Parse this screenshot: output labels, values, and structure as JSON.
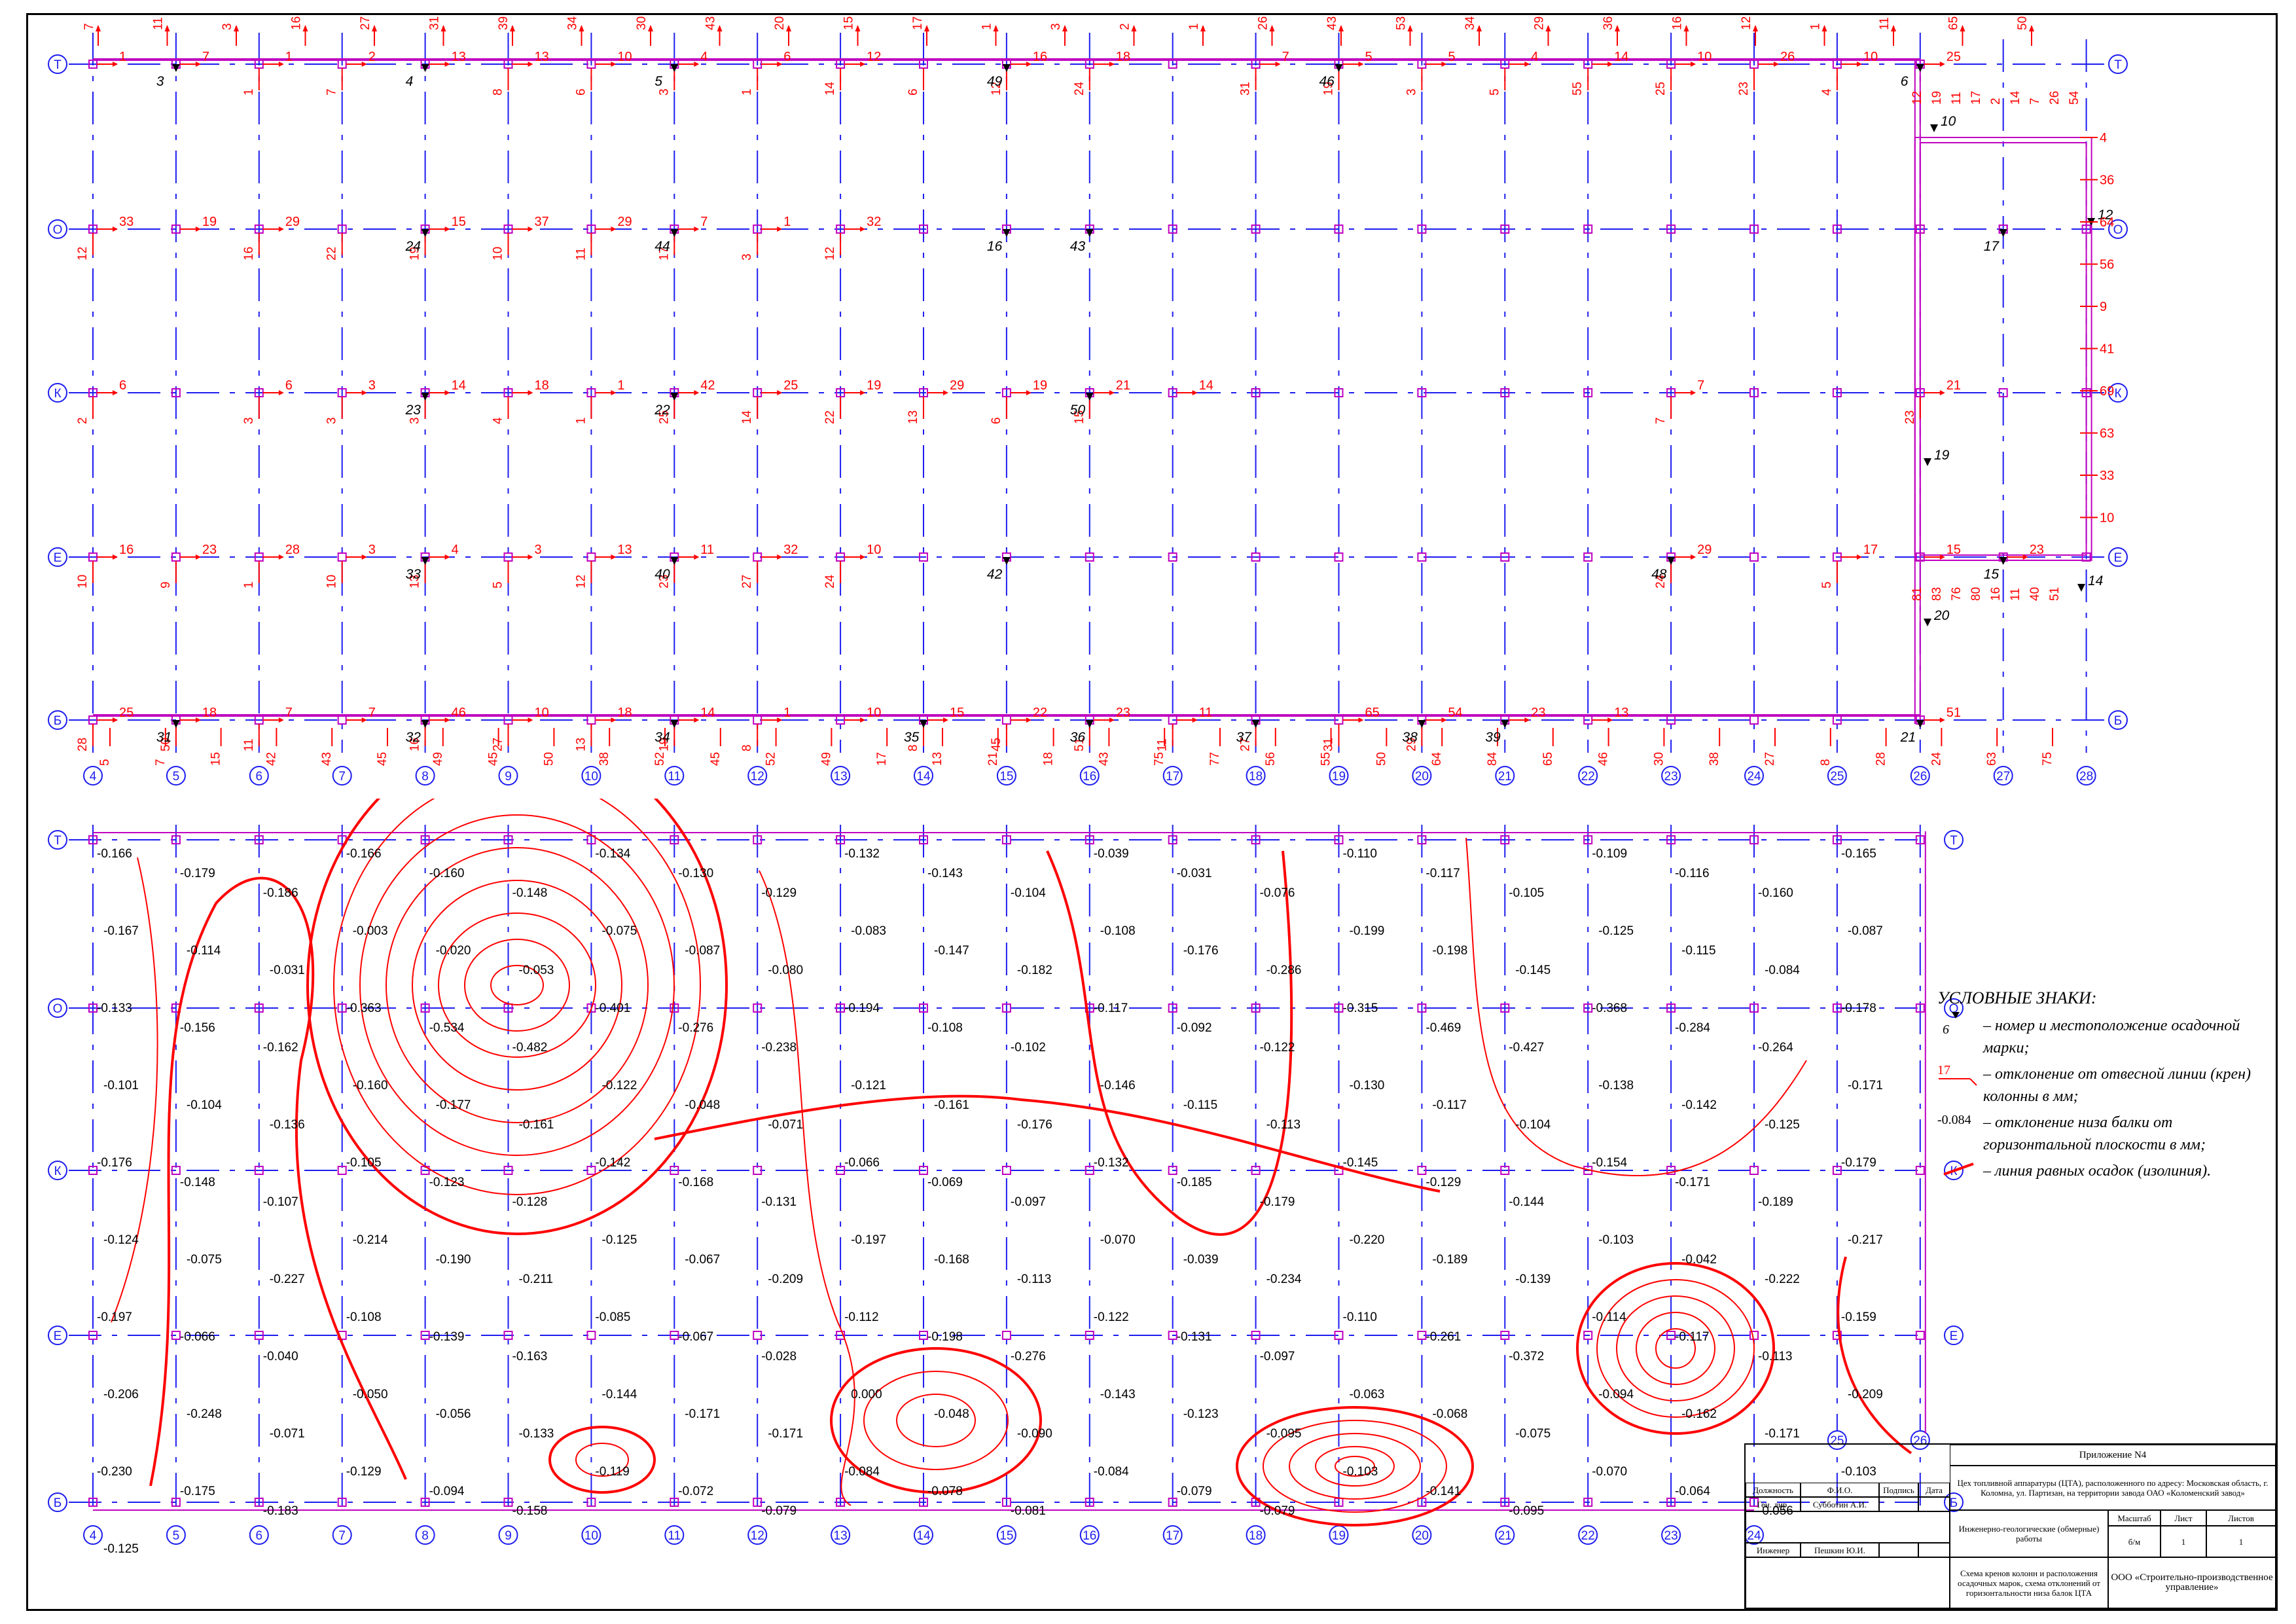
{
  "colors": {
    "grid": "#1d1df0",
    "red": "#ff0000",
    "mark": "#c000c0",
    "black": "#000000"
  },
  "plan1": {
    "axes_x": [
      "4",
      "5",
      "6",
      "7",
      "8",
      "9",
      "10",
      "11",
      "12",
      "13",
      "14",
      "15",
      "16",
      "17",
      "18",
      "19",
      "20",
      "21",
      "22",
      "23",
      "24",
      "25",
      "26",
      "27",
      "28"
    ],
    "axes_y": [
      "Т",
      "О",
      "К",
      "Е",
      "Б"
    ],
    "top_numbers": [
      "7",
      "11",
      "3",
      "16",
      "27",
      "31",
      "39",
      "34",
      "30",
      "43",
      "20",
      "15",
      "17",
      "1",
      "3",
      "2",
      "1",
      "26",
      "43",
      "53",
      "34",
      "29",
      "36",
      "16",
      "12",
      "1",
      "11",
      "65",
      "50"
    ],
    "red_numbers": [
      {
        "c": 0,
        "r": 0,
        "t": "1"
      },
      {
        "c": 1,
        "r": 0,
        "t": "7"
      },
      {
        "c": 2,
        "r": 0,
        "t": "1"
      },
      {
        "c": 3,
        "r": 0,
        "t": "2"
      },
      {
        "c": 4,
        "r": 0,
        "t": "13"
      },
      {
        "c": 5,
        "r": 0,
        "t": "13"
      },
      {
        "c": 6,
        "r": 0,
        "t": "10"
      },
      {
        "c": 7,
        "r": 0,
        "t": "4"
      },
      {
        "c": 8,
        "r": 0,
        "t": "6"
      },
      {
        "c": 9,
        "r": 0,
        "t": "12"
      },
      {
        "c": 11,
        "r": 0,
        "t": "16"
      },
      {
        "c": 12,
        "r": 0,
        "t": "18"
      },
      {
        "c": 14,
        "r": 0,
        "t": "7"
      },
      {
        "c": 15,
        "r": 0,
        "t": "5"
      },
      {
        "c": 16,
        "r": 0,
        "t": "5"
      },
      {
        "c": 17,
        "r": 0,
        "t": "4"
      },
      {
        "c": 18,
        "r": 0,
        "t": "14"
      },
      {
        "c": 19,
        "r": 0,
        "t": "10"
      },
      {
        "c": 20,
        "r": 0,
        "t": "26"
      },
      {
        "c": 21,
        "r": 0,
        "t": "10"
      },
      {
        "c": 22,
        "r": 0,
        "t": "25"
      },
      {
        "c": 0,
        "r": 1,
        "t": "33"
      },
      {
        "c": 1,
        "r": 1,
        "t": "19"
      },
      {
        "c": 2,
        "r": 1,
        "t": "29"
      },
      {
        "c": 4,
        "r": 1,
        "t": "15"
      },
      {
        "c": 5,
        "r": 1,
        "t": "37"
      },
      {
        "c": 6,
        "r": 1,
        "t": "29"
      },
      {
        "c": 7,
        "r": 1,
        "t": "7"
      },
      {
        "c": 8,
        "r": 1,
        "t": "1"
      },
      {
        "c": 9,
        "r": 1,
        "t": "32"
      },
      {
        "c": 0,
        "r": 2,
        "t": "6"
      },
      {
        "c": 2,
        "r": 2,
        "t": "6"
      },
      {
        "c": 3,
        "r": 2,
        "t": "3"
      },
      {
        "c": 4,
        "r": 2,
        "t": "14"
      },
      {
        "c": 5,
        "r": 2,
        "t": "18"
      },
      {
        "c": 6,
        "r": 2,
        "t": "1"
      },
      {
        "c": 7,
        "r": 2,
        "t": "42"
      },
      {
        "c": 8,
        "r": 2,
        "t": "25"
      },
      {
        "c": 9,
        "r": 2,
        "t": "19"
      },
      {
        "c": 10,
        "r": 2,
        "t": "29"
      },
      {
        "c": 11,
        "r": 2,
        "t": "19"
      },
      {
        "c": 12,
        "r": 2,
        "t": "21"
      },
      {
        "c": 13,
        "r": 2,
        "t": "14"
      },
      {
        "c": 19,
        "r": 2,
        "t": "7"
      },
      {
        "c": 22,
        "r": 2,
        "t": "21"
      },
      {
        "c": 0,
        "r": 3,
        "t": "16"
      },
      {
        "c": 1,
        "r": 3,
        "t": "23"
      },
      {
        "c": 2,
        "r": 3,
        "t": "28"
      },
      {
        "c": 3,
        "r": 3,
        "t": "3"
      },
      {
        "c": 4,
        "r": 3,
        "t": "4"
      },
      {
        "c": 5,
        "r": 3,
        "t": "3"
      },
      {
        "c": 6,
        "r": 3,
        "t": "13"
      },
      {
        "c": 7,
        "r": 3,
        "t": "11"
      },
      {
        "c": 8,
        "r": 3,
        "t": "32"
      },
      {
        "c": 9,
        "r": 3,
        "t": "10"
      },
      {
        "c": 19,
        "r": 3,
        "t": "29"
      },
      {
        "c": 21,
        "r": 3,
        "t": "17"
      },
      {
        "c": 22,
        "r": 3,
        "t": "15"
      },
      {
        "c": 23,
        "r": 3,
        "t": "23"
      },
      {
        "c": 0,
        "r": 4,
        "t": "25"
      },
      {
        "c": 1,
        "r": 4,
        "t": "18"
      },
      {
        "c": 2,
        "r": 4,
        "t": "7"
      },
      {
        "c": 3,
        "r": 4,
        "t": "7"
      },
      {
        "c": 4,
        "r": 4,
        "t": "46"
      },
      {
        "c": 5,
        "r": 4,
        "t": "10"
      },
      {
        "c": 6,
        "r": 4,
        "t": "18"
      },
      {
        "c": 7,
        "r": 4,
        "t": "14"
      },
      {
        "c": 8,
        "r": 4,
        "t": "1"
      },
      {
        "c": 9,
        "r": 4,
        "t": "10"
      },
      {
        "c": 10,
        "r": 4,
        "t": "15"
      },
      {
        "c": 11,
        "r": 4,
        "t": "22"
      },
      {
        "c": 12,
        "r": 4,
        "t": "23"
      },
      {
        "c": 13,
        "r": 4,
        "t": "11"
      },
      {
        "c": 15,
        "r": 4,
        "t": "65"
      },
      {
        "c": 16,
        "r": 4,
        "t": "54"
      },
      {
        "c": 17,
        "r": 4,
        "t": "23"
      },
      {
        "c": 18,
        "r": 4,
        "t": "13"
      },
      {
        "c": 22,
        "r": 4,
        "t": "51"
      }
    ],
    "vert_numbers": [
      {
        "c": 0,
        "r": 1,
        "t": "12"
      },
      {
        "c": 0,
        "r": 2,
        "t": "2"
      },
      {
        "c": 0,
        "r": 3,
        "t": "10"
      },
      {
        "c": 0,
        "r": 4,
        "t": "28"
      },
      {
        "c": 1,
        "r": 3,
        "t": "9"
      },
      {
        "c": 1,
        "r": 4,
        "t": "50"
      },
      {
        "c": 2,
        "r": 0,
        "t": "1"
      },
      {
        "c": 2,
        "r": 1,
        "t": "16"
      },
      {
        "c": 2,
        "r": 2,
        "t": "3"
      },
      {
        "c": 2,
        "r": 3,
        "t": "1"
      },
      {
        "c": 2,
        "r": 4,
        "t": "11"
      },
      {
        "c": 3,
        "r": 0,
        "t": "7"
      },
      {
        "c": 3,
        "r": 1,
        "t": "22"
      },
      {
        "c": 3,
        "r": 2,
        "t": "3"
      },
      {
        "c": 3,
        "r": 3,
        "t": "10"
      },
      {
        "c": 4,
        "r": 1,
        "t": "19"
      },
      {
        "c": 4,
        "r": 2,
        "t": "3"
      },
      {
        "c": 4,
        "r": 3,
        "t": "13"
      },
      {
        "c": 4,
        "r": 4,
        "t": "16"
      },
      {
        "c": 5,
        "r": 0,
        "t": "8"
      },
      {
        "c": 5,
        "r": 1,
        "t": "10"
      },
      {
        "c": 5,
        "r": 2,
        "t": "4"
      },
      {
        "c": 5,
        "r": 3,
        "t": "5"
      },
      {
        "c": 5,
        "r": 4,
        "t": "27"
      },
      {
        "c": 6,
        "r": 0,
        "t": "6"
      },
      {
        "c": 6,
        "r": 1,
        "t": "11"
      },
      {
        "c": 6,
        "r": 2,
        "t": "1"
      },
      {
        "c": 6,
        "r": 3,
        "t": "12"
      },
      {
        "c": 6,
        "r": 4,
        "t": "13"
      },
      {
        "c": 7,
        "r": 0,
        "t": "3"
      },
      {
        "c": 7,
        "r": 1,
        "t": "17"
      },
      {
        "c": 7,
        "r": 2,
        "t": "25"
      },
      {
        "c": 7,
        "r": 3,
        "t": "23"
      },
      {
        "c": 7,
        "r": 4,
        "t": "19"
      },
      {
        "c": 8,
        "r": 0,
        "t": "1"
      },
      {
        "c": 8,
        "r": 1,
        "t": "3"
      },
      {
        "c": 8,
        "r": 2,
        "t": "14"
      },
      {
        "c": 8,
        "r": 3,
        "t": "27"
      },
      {
        "c": 8,
        "r": 4,
        "t": "8"
      },
      {
        "c": 9,
        "r": 0,
        "t": "14"
      },
      {
        "c": 9,
        "r": 1,
        "t": "12"
      },
      {
        "c": 9,
        "r": 2,
        "t": "22"
      },
      {
        "c": 9,
        "r": 3,
        "t": "24"
      },
      {
        "c": 10,
        "r": 0,
        "t": "6"
      },
      {
        "c": 10,
        "r": 2,
        "t": "13"
      },
      {
        "c": 10,
        "r": 4,
        "t": "8"
      },
      {
        "c": 11,
        "r": 0,
        "t": "12"
      },
      {
        "c": 11,
        "r": 2,
        "t": "6"
      },
      {
        "c": 11,
        "r": 4,
        "t": "45"
      },
      {
        "c": 12,
        "r": 0,
        "t": "24"
      },
      {
        "c": 12,
        "r": 2,
        "t": "15"
      },
      {
        "c": 12,
        "r": 4,
        "t": "51"
      },
      {
        "c": 13,
        "r": 4,
        "t": "11"
      },
      {
        "c": 14,
        "r": 0,
        "t": "31"
      },
      {
        "c": 14,
        "r": 4,
        "t": "27"
      },
      {
        "c": 15,
        "r": 0,
        "t": "19"
      },
      {
        "c": 15,
        "r": 4,
        "t": "31"
      },
      {
        "c": 16,
        "r": 0,
        "t": "3"
      },
      {
        "c": 16,
        "r": 4,
        "t": "29"
      },
      {
        "c": 17,
        "r": 0,
        "t": "5"
      },
      {
        "c": 18,
        "r": 0,
        "t": "55"
      },
      {
        "c": 19,
        "r": 0,
        "t": "25"
      },
      {
        "c": 19,
        "r": 2,
        "t": "7"
      },
      {
        "c": 19,
        "r": 3,
        "t": "24"
      },
      {
        "c": 20,
        "r": 0,
        "t": "23"
      },
      {
        "c": 21,
        "r": 0,
        "t": "4"
      },
      {
        "c": 21,
        "r": 3,
        "t": "5"
      },
      {
        "c": 22,
        "r": 2,
        "t": "23"
      }
    ],
    "bottom_numbers": [
      "5",
      "7",
      "15",
      "42",
      "43",
      "45",
      "49",
      "45",
      "50",
      "38",
      "52",
      "45",
      "52",
      "49",
      "17",
      "13",
      "21",
      "18",
      "43",
      "75",
      "77",
      "56",
      "55",
      "50",
      "64",
      "84",
      "65",
      "46",
      "30",
      "38",
      "27",
      "8",
      "28",
      "24",
      "63",
      "75"
    ],
    "markers": [
      {
        "c": 1,
        "r": 0,
        "t": "3"
      },
      {
        "c": 4,
        "r": 0,
        "t": "4"
      },
      {
        "c": 7,
        "r": 0,
        "t": "5"
      },
      {
        "c": 11,
        "r": 0,
        "t": "49"
      },
      {
        "c": 15,
        "r": 0,
        "t": "46"
      },
      {
        "c": 22,
        "r": 0,
        "t": "6"
      },
      {
        "c": 4,
        "r": 1,
        "t": "24"
      },
      {
        "c": 7,
        "r": 1,
        "t": "44"
      },
      {
        "c": 11,
        "r": 1,
        "t": "16"
      },
      {
        "c": 12,
        "r": 1,
        "t": "43"
      },
      {
        "c": 23,
        "r": 1,
        "t": "17"
      },
      {
        "c": 4,
        "r": 2,
        "t": "23"
      },
      {
        "c": 7,
        "r": 2,
        "t": "22"
      },
      {
        "c": 12,
        "r": 2,
        "t": "50"
      },
      {
        "c": 4,
        "r": 3,
        "t": "33"
      },
      {
        "c": 7,
        "r": 3,
        "t": "40"
      },
      {
        "c": 11,
        "r": 3,
        "t": "42"
      },
      {
        "c": 19,
        "r": 3,
        "t": "48"
      },
      {
        "c": 23,
        "r": 3,
        "t": "15"
      },
      {
        "c": 1,
        "r": 4,
        "t": "31"
      },
      {
        "c": 4,
        "r": 4,
        "t": "32"
      },
      {
        "c": 7,
        "r": 4,
        "t": "34"
      },
      {
        "c": 10,
        "r": 4,
        "t": "35"
      },
      {
        "c": 12,
        "r": 4,
        "t": "36"
      },
      {
        "c": 14,
        "r": 4,
        "t": "37"
      },
      {
        "c": 16,
        "r": 4,
        "t": "38"
      },
      {
        "c": 17,
        "r": 4,
        "t": "39"
      },
      {
        "c": 22,
        "r": 4,
        "t": "21"
      }
    ],
    "extra_markers": [
      "10",
      "12",
      "19",
      "20",
      "14"
    ],
    "right_numbers": [
      "4",
      "36",
      "64",
      "56",
      "9",
      "41",
      "69",
      "63",
      "33",
      "10"
    ],
    "right_lower_numbers": [
      "12",
      "19",
      "11",
      "17",
      "2",
      "14",
      "7",
      "26",
      "54",
      "81",
      "83",
      "76",
      "80",
      "16",
      "11",
      "40",
      "51"
    ]
  },
  "plan2": {
    "axes_x": [
      "4",
      "5",
      "6",
      "7",
      "8",
      "9",
      "10",
      "11",
      "12",
      "13",
      "14",
      "15",
      "16",
      "17",
      "18",
      "19",
      "20",
      "21",
      "22",
      "23",
      "24",
      "25",
      "26"
    ],
    "axes_y": [
      "Т",
      "О",
      "К",
      "Е",
      "Б"
    ],
    "values": [
      "-0.166",
      "-0.179",
      "-0.186",
      "-0.166",
      "-0.160",
      "-0.148",
      "-0.134",
      "-0.130",
      "-0.129",
      "-0.132",
      "-0.143",
      "-0.104",
      "-0.039",
      "-0.031",
      "-0.076",
      "-0.110",
      "-0.117",
      "-0.105",
      "-0.109",
      "-0.116",
      "-0.160",
      "-0.165",
      "-0.167",
      "-0.114",
      "-0.031",
      "-0.003",
      "-0.020",
      "-0.053",
      "-0.075",
      "-0.087",
      "-0.080",
      "-0.083",
      "-0.147",
      "-0.182",
      "-0.108",
      "-0.176",
      "-0.286",
      "-0.199",
      "-0.198",
      "-0.145",
      "-0.125",
      "-0.115",
      "-0.084",
      "-0.087",
      "-0.133",
      "-0.156",
      "-0.162",
      "-0.363",
      "-0.534",
      "-0.482",
      "-0.401",
      "-0.276",
      "-0.238",
      "-0.194",
      "-0.108",
      "-0.102",
      "-0.117",
      "-0.092",
      "-0.122",
      "-0.315",
      "-0.469",
      "-0.427",
      "-0.368",
      "-0.284",
      "-0.264",
      "-0.178",
      "-0.101",
      "-0.104",
      "-0.136",
      "-0.160",
      "-0.177",
      "-0.161",
      "-0.122",
      "-0.048",
      "-0.071",
      "-0.121",
      "-0.161",
      "-0.176",
      "-0.146",
      "-0.115",
      "-0.113",
      "-0.130",
      "-0.117",
      "-0.104",
      "-0.138",
      "-0.142",
      "-0.125",
      "-0.171",
      "-0.176",
      "-0.148",
      "-0.107",
      "-0.105",
      "-0.123",
      "-0.128",
      "-0.142",
      "-0.168",
      "-0.131",
      "-0.066",
      "-0.069",
      "-0.097",
      "-0.132",
      "-0.185",
      "-0.179",
      "-0.145",
      "-0.129",
      "-0.144",
      "-0.154",
      "-0.171",
      "-0.189",
      "-0.179",
      "-0.124",
      "-0.075",
      "-0.227",
      "-0.214",
      "-0.190",
      "-0.211",
      "-0.125",
      "-0.067",
      "-0.209",
      "-0.197",
      "-0.168",
      "-0.113",
      "-0.070",
      "-0.039",
      "-0.234",
      "-0.220",
      "-0.189",
      "-0.139",
      "-0.103",
      "-0.042",
      "-0.222",
      "-0.217",
      "-0.197",
      "-0.066",
      "-0.040",
      "-0.108",
      "-0.139",
      "-0.163",
      "-0.085",
      "-0.067",
      "-0.028",
      "-0.112",
      "-0.198",
      "-0.276",
      "-0.122",
      "-0.131",
      "-0.097",
      "-0.110",
      "-0.261",
      "-0.372",
      "-0.114",
      "-0.117",
      "-0.113",
      "-0.159",
      "-0.206",
      "-0.248",
      "-0.071",
      "-0.050",
      "-0.056",
      "-0.133",
      "-0.144",
      "-0.171",
      "-0.171",
      "0.000",
      "-0.048",
      "-0.090",
      "-0.143",
      "-0.123",
      "-0.095",
      "-0.063",
      "-0.068",
      "-0.075",
      "-0.094",
      "-0.162",
      "-0.171",
      "-0.209",
      "-0.230",
      "-0.175",
      "-0.183",
      "-0.129",
      "-0.094",
      "-0.158",
      "-0.119",
      "-0.072",
      "-0.079",
      "-0.084",
      "-0.078",
      "-0.081",
      "-0.084",
      "-0.079",
      "-0.079",
      "-0.103",
      "-0.141",
      "-0.095",
      "-0.070",
      "-0.064",
      "-0.056",
      "-0.103",
      "-0.125"
    ]
  },
  "legend": {
    "title": "УСЛОВНЫЕ ЗНАКИ:",
    "mark_sample": "6",
    "crane_sample": "17",
    "beam_sample": "-0.084",
    "items": [
      "– номер и местоположение осадочной марки;",
      "– отклонение от отвесной линии (крен) колонны в мм;",
      "– отклонение низа балки от горизонтальной плоскости в мм;",
      "– линия равных осадок (изолиния)."
    ]
  },
  "stamp": {
    "appendix": "Приложение N4",
    "h_position": "Должность",
    "h_name": "Ф.И.О.",
    "h_sign": "Подпись",
    "h_date": "Дата",
    "r1_pos": "Ген. дир.",
    "r1_name": "Субботин А.И.",
    "r2_pos": "Инженер",
    "r2_name": "Пешкин Ю.И.",
    "object": "Цех топливной аппаратуры (ЦТА), расположенного по адресу: Московская область, г. Коломна, ул. Партизан, на территории завода ОАО «Коломенский завод»",
    "work": "Инженерно-геологические (обмерные) работы",
    "h_scale": "Масштаб",
    "h_sheet": "Лист",
    "h_sheets": "Листов",
    "scale": "б/м",
    "sheet": "1",
    "sheets": "1",
    "title": "Схема кренов колонн и расположения осадочных марок, схема отклонений от горизонтальности низа балок ЦТА",
    "org": "ООО «Строительно-производственное управление»"
  }
}
